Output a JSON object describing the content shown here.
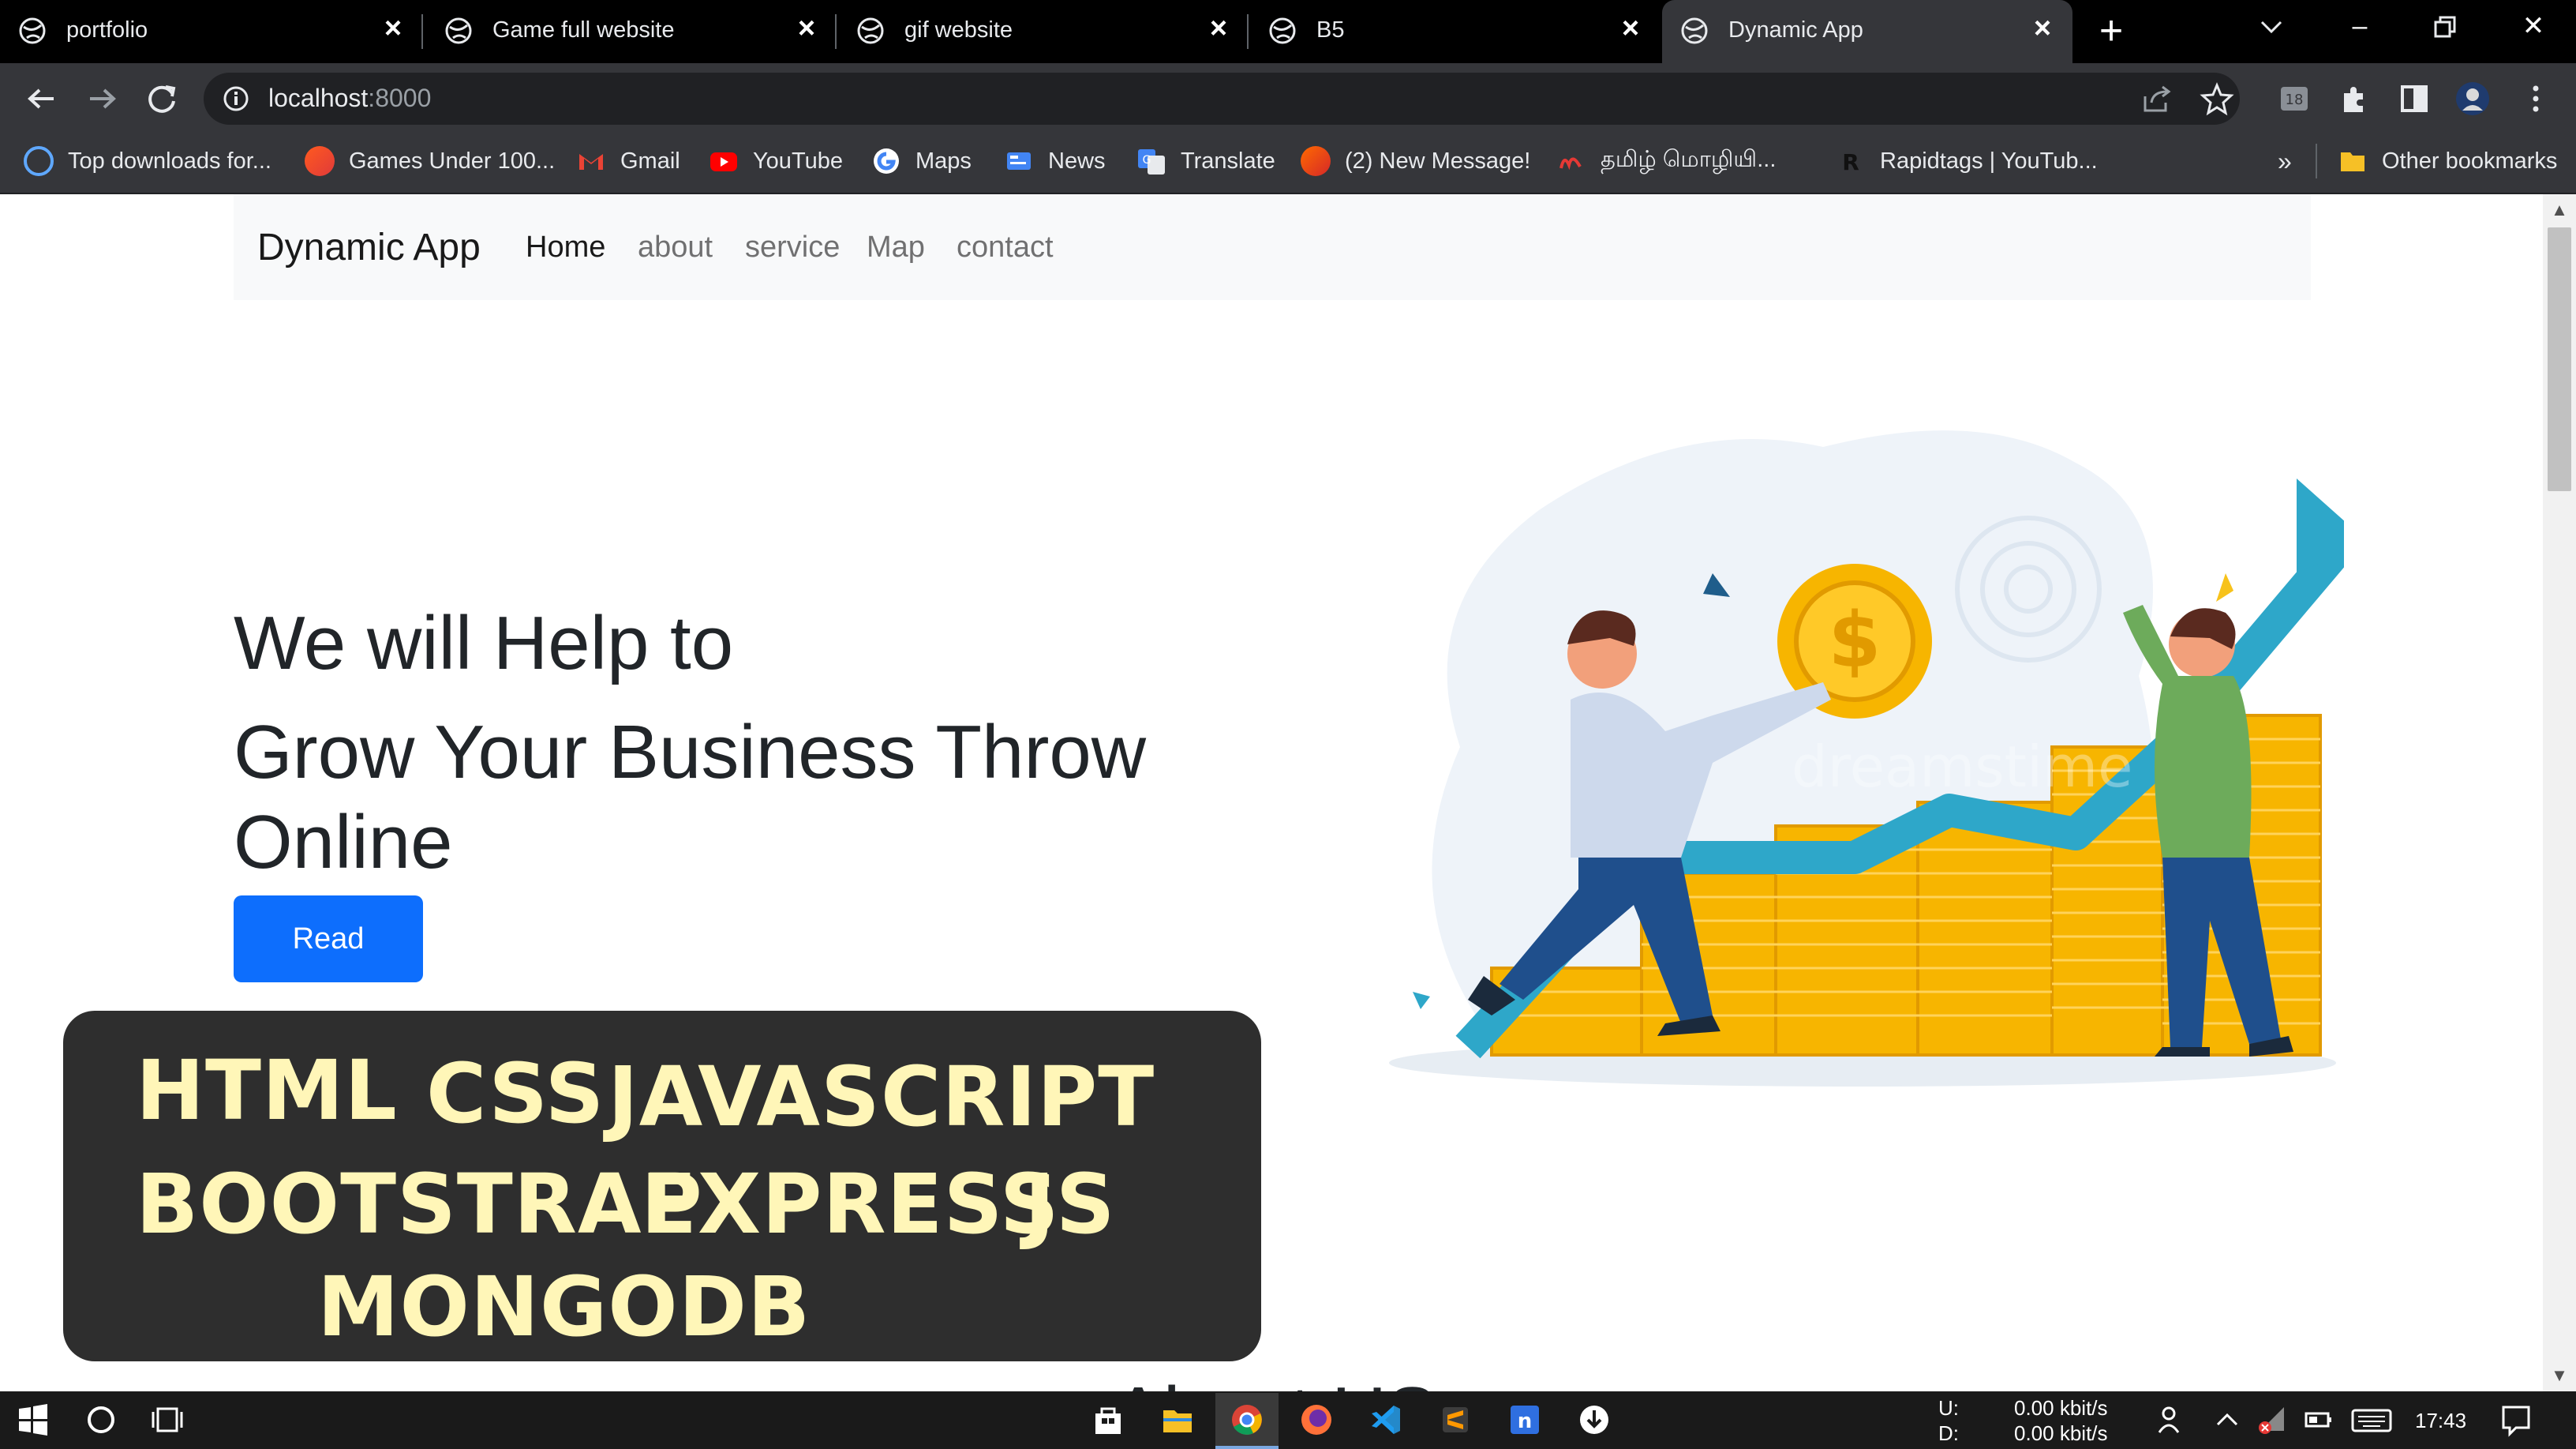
{
  "browser": {
    "tabs": [
      {
        "title": "portfolio",
        "active": false
      },
      {
        "title": "Game full website",
        "active": false
      },
      {
        "title": "gif website",
        "active": false
      },
      {
        "title": "B5",
        "active": false
      },
      {
        "title": "Dynamic App",
        "active": true
      }
    ],
    "address": {
      "host": "localhost",
      "port": ":8000"
    },
    "bookmarks": [
      {
        "label": "Top downloads for...",
        "icon": "globe-icon"
      },
      {
        "label": "Games Under 100...",
        "icon": "game-site-icon"
      },
      {
        "label": "Gmail",
        "icon": "gmail-icon"
      },
      {
        "label": "YouTube",
        "icon": "youtube-icon"
      },
      {
        "label": "Maps",
        "icon": "google-icon"
      },
      {
        "label": "News",
        "icon": "news-icon"
      },
      {
        "label": "Translate",
        "icon": "translate-icon"
      },
      {
        "label": "(2) New Message!",
        "icon": "message-site-icon"
      },
      {
        "label": "தமிழ் மொழியி...",
        "icon": "tamil-site-icon"
      },
      {
        "label": "Rapidtags | YouTub...",
        "icon": "rapidtags-icon"
      }
    ],
    "bookmarks_more": "»",
    "other_bookmarks": "Other bookmarks"
  },
  "page": {
    "brand": "Dynamic App",
    "nav": [
      "Home",
      "about",
      "service",
      "Map",
      "contact"
    ],
    "hero_line1": "We will Help to",
    "hero_line2": "Grow Your Business Throw Online",
    "read_button": "Read",
    "next_section_peek": "About US",
    "illustration_watermark": "dreamstime"
  },
  "overlay": {
    "line1a": "HTML",
    "line1b": "CSS",
    "line1c": "JAVASCRIPT",
    "line2a": "BOOTSTRAP",
    "line2b": "EXPRESS",
    "line2c": "JS",
    "line3": "MONGODB"
  },
  "taskbar": {
    "upload_label": "U:",
    "download_label": "D:",
    "upload_speed": "0.00 kbit/s",
    "download_speed": "0.00 kbit/s",
    "time": "17:43"
  },
  "colors": {
    "primary": "#0d6efd",
    "navbar_bg": "#f8f9fa",
    "overlay_bg": "#2e2e2e",
    "overlay_text": "#fff6b8",
    "coin_gold": "#f7b500",
    "chart_arrow": "#2ea7c9"
  }
}
